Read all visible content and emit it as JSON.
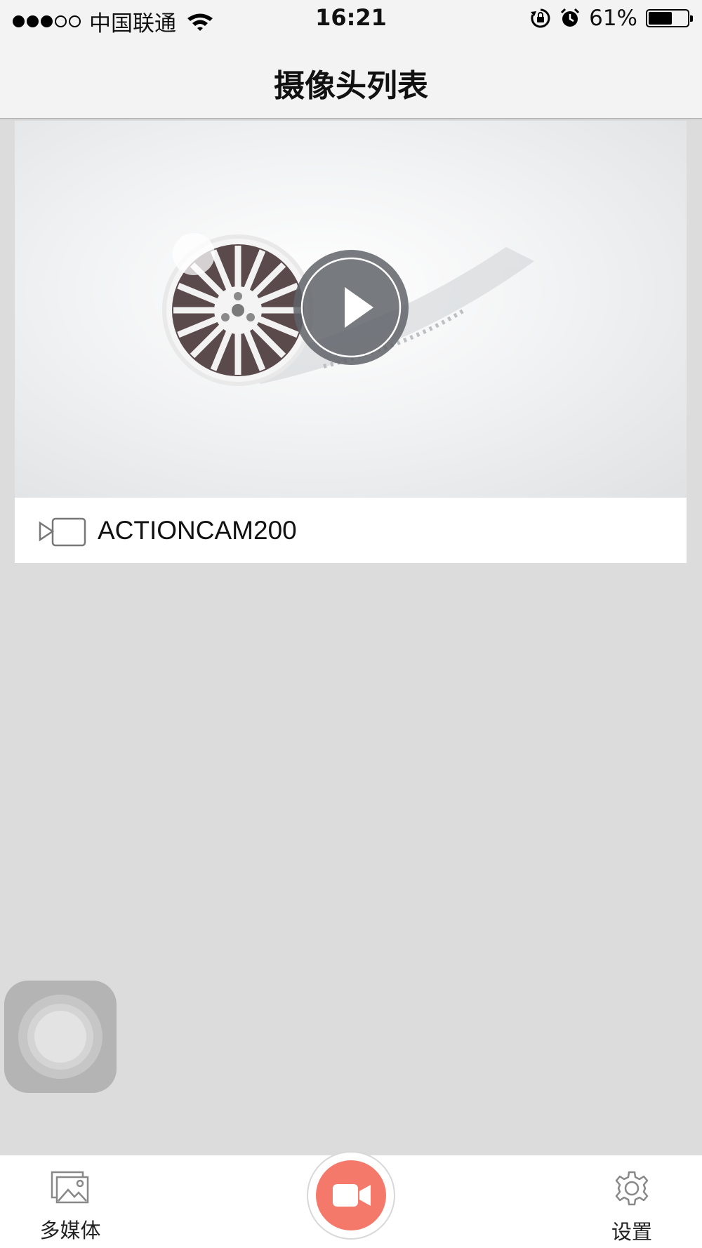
{
  "status_bar": {
    "carrier": "中国联通",
    "time": "16:21",
    "battery": "61%",
    "battery_level": 0.61
  },
  "nav": {
    "title": "摄像头列表"
  },
  "cameras": [
    {
      "name": "ACTIONCAM200"
    }
  ],
  "tab_bar": {
    "media_label": "多媒体",
    "settings_label": "设置"
  },
  "colors": {
    "record_button": "#f5796a",
    "background": "#dcdcdc",
    "bar": "#f3f3f3"
  },
  "icons": {
    "media": "image-icon",
    "record": "video-camera-icon",
    "settings": "gear-icon",
    "camera_item": "camera-outline-icon",
    "play": "play-icon"
  }
}
